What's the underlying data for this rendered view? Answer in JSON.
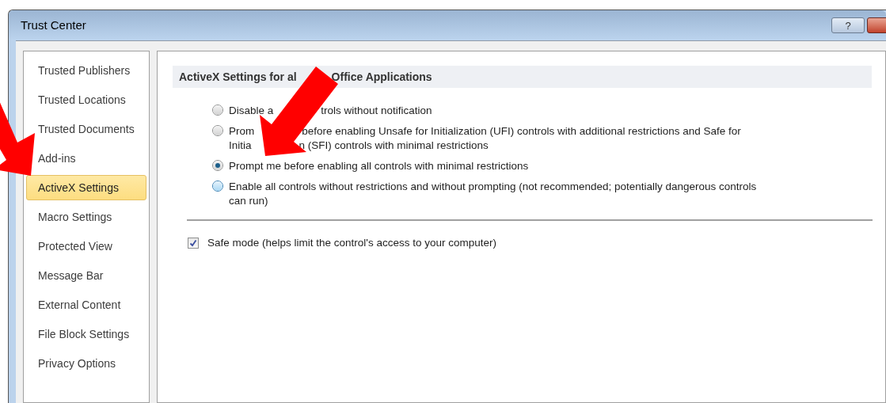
{
  "window": {
    "title": "Trust Center",
    "buttons": [
      {
        "kind": "help",
        "label": "?"
      },
      {
        "kind": "close"
      }
    ]
  },
  "sidebar": {
    "items": [
      {
        "label": "Trusted Publishers",
        "selected": false
      },
      {
        "label": "Trusted Locations",
        "selected": false
      },
      {
        "label": "Trusted Documents",
        "selected": false
      },
      {
        "label": "Add-ins",
        "selected": false
      },
      {
        "label": "ActiveX Settings",
        "selected": true
      },
      {
        "label": "Macro Settings",
        "selected": false
      },
      {
        "label": "Protected View",
        "selected": false
      },
      {
        "label": "Message Bar",
        "selected": false
      },
      {
        "label": "External Content",
        "selected": false
      },
      {
        "label": "File Block Settings",
        "selected": false
      },
      {
        "label": "Privacy Options",
        "selected": false
      }
    ]
  },
  "section": {
    "heading": [
      "ActiveX Settings for al",
      "Office Applications"
    ],
    "options": [
      {
        "lines": [
          [
            "Disable a",
            "trols without notification"
          ]
        ],
        "selected": false,
        "hovered": false
      },
      {
        "lines": [
          [
            "Prom",
            "before enabling Unsafe for Initialization (UFI) controls with additional restrictions and Safe for"
          ],
          [
            "Initia",
            "n (SFI) controls with minimal restrictions"
          ]
        ],
        "selected": false,
        "hovered": false
      },
      {
        "lines": [
          [
            "Prompt me before enabling all controls with minimal restrictions"
          ]
        ],
        "selected": true,
        "hovered": false
      },
      {
        "lines": [
          [
            "Enable all controls without restrictions and without prompting (not recommended; potentially dangerous controls"
          ],
          [
            "can run)"
          ]
        ],
        "selected": false,
        "hovered": true
      }
    ],
    "safe_mode": {
      "label": "Safe mode (helps limit the control's access to your computer)",
      "checked": true
    }
  },
  "annotations": [
    {
      "kind": "arrow"
    },
    {
      "kind": "arrow"
    }
  ]
}
